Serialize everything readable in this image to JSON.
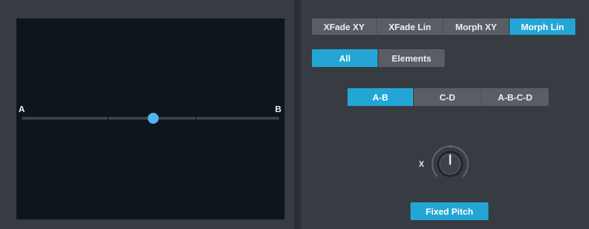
{
  "xy_pad": {
    "label_a": "A",
    "label_b": "B",
    "position": 0.5
  },
  "mode_tabs": {
    "items": [
      "XFade XY",
      "XFade Lin",
      "Morph XY",
      "Morph Lin"
    ],
    "selected": "Morph Lin"
  },
  "filter_tabs": {
    "items": [
      "All",
      "Elements"
    ],
    "selected": "All"
  },
  "pair_tabs": {
    "items": [
      "A-B",
      "C-D",
      "A-B-C-D"
    ],
    "selected": "A-B"
  },
  "x_knob": {
    "label": "X",
    "value": 0.5
  },
  "fixed_pitch": {
    "label": "Fixed Pitch",
    "active": true
  },
  "colors": {
    "accent": "#23a6d5",
    "handle": "#4fb5ea",
    "pad_bg": "#0d151d",
    "panel_bg": "#373c43"
  }
}
